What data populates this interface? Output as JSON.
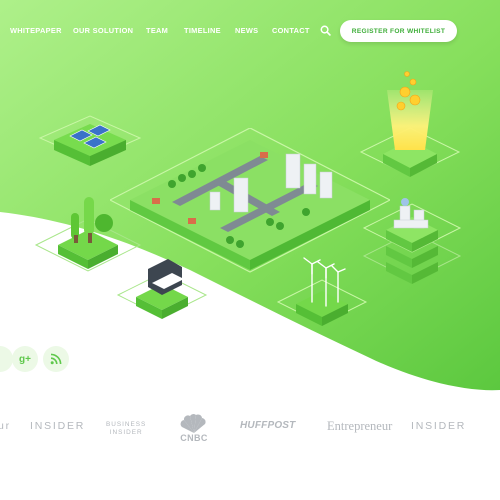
{
  "nav": {
    "items": [
      {
        "label": "WHITEPAPER"
      },
      {
        "label": "OUR SOLUTION"
      },
      {
        "label": "TEAM"
      },
      {
        "label": "TIMELINE"
      },
      {
        "label": "NEWS"
      },
      {
        "label": "CONTACT"
      }
    ],
    "search_icon": "search-icon",
    "cta_label": "REGISTER FOR WHITELIST"
  },
  "social": [
    {
      "icon": "google-plus-icon",
      "label": "g+"
    },
    {
      "icon": "rss-icon"
    }
  ],
  "press": {
    "left_partial": "ur",
    "insider_1": "INSIDER",
    "business_insider_line1": "BUSINESS",
    "business_insider_line2": "INSIDER",
    "cnbc": "CNBC",
    "huffpost": "HUFFPOST",
    "entrepreneur": "Entrepreneur",
    "insider_2": "INSIDER"
  },
  "colors": {
    "green_light": "#a6ec7c",
    "green_mid": "#7fdd55",
    "green_dark": "#55c43a",
    "text_light": "#ffffff",
    "logo_gray": "#b4b8bd",
    "cta_text": "#3fae3a"
  },
  "illustration": {
    "tiles": [
      "solar-panels-tile",
      "city-tile",
      "trees-tile",
      "printer-tile",
      "wind-turbines-tile",
      "token-beam-tile",
      "factory-tile"
    ]
  }
}
